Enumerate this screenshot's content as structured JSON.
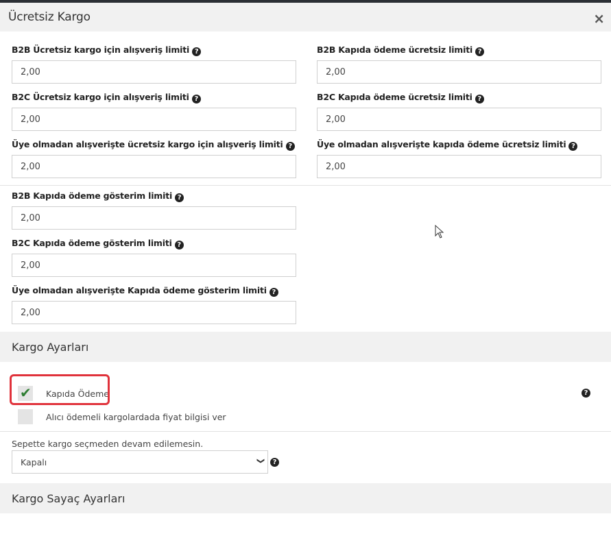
{
  "modal": {
    "title": "Ücretsiz Kargo",
    "close_label": "×"
  },
  "limits_grid": [
    {
      "label": "B2B Ücretsiz kargo için alışveriş limiti",
      "value": "2,00"
    },
    {
      "label": "B2B Kapıda ödeme ücretsiz limiti",
      "value": "2,00"
    },
    {
      "label": "B2C Ücretsiz kargo için alışveriş limiti",
      "value": "2,00"
    },
    {
      "label": "B2C Kapıda ödeme ücretsiz limiti",
      "value": "2,00"
    },
    {
      "label": "Üye olmadan alışverişte ücretsiz kargo için alışveriş limiti",
      "value": "2,00"
    },
    {
      "label": "Üye olmadan alışverişte kapıda ödeme ücretsiz limiti",
      "value": "2,00"
    }
  ],
  "display_limits": [
    {
      "label": "B2B Kapıda ödeme gösterim limiti",
      "value": "2,00"
    },
    {
      "label": "B2C Kapıda ödeme gösterim limiti",
      "value": "2,00"
    },
    {
      "label": "Üye olmadan alışverişte Kapıda ödeme gösterim limiti",
      "value": "2,00"
    }
  ],
  "help_glyph": "?",
  "kargo_ayarlari": {
    "title": "Kargo Ayarları",
    "checkboxes": [
      {
        "label": "Kapıda Ödeme",
        "checked": true,
        "check_glyph": "✔"
      },
      {
        "label": "Alıcı ödemeli kargolardada fiyat bilgisi ver",
        "checked": false
      }
    ],
    "select_label": "Sepette kargo seçmeden devam edilemesin.",
    "select_value": "Kapalı",
    "select_arrow": "❯"
  },
  "sayac": {
    "title": "Kargo Sayaç Ayarları"
  },
  "colors": {
    "highlight": "#e0323b",
    "check": "#2e7d32",
    "header_bg": "#f1f1f1"
  }
}
